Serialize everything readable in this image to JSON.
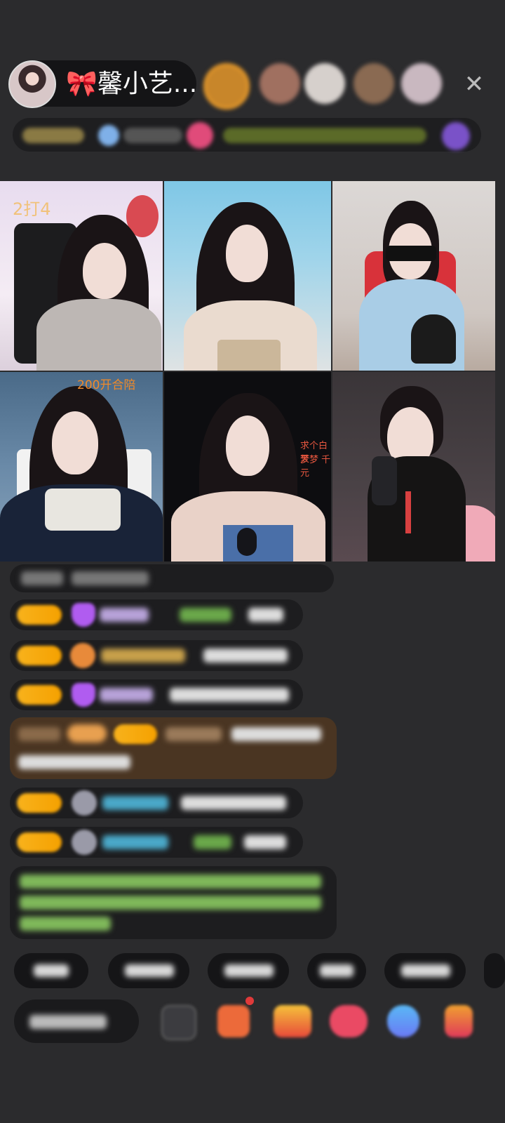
{
  "header": {
    "host_name": "🎀馨小艺...",
    "close_label": "✕"
  },
  "stream": {
    "tile_1_overlay": "2打4",
    "tile_4_overlay": "200开合陪",
    "tile_5_overlay_lines": [
      "求个白天",
      "梦梦 千元"
    ]
  },
  "icons": {
    "close": "close-icon",
    "emoji": "emoji-icon",
    "gift": "gift-icon"
  },
  "colors": {
    "background": "#2b2b2d",
    "badge_yellow": "#f8b21c",
    "accent_red": "#e94b3c"
  }
}
